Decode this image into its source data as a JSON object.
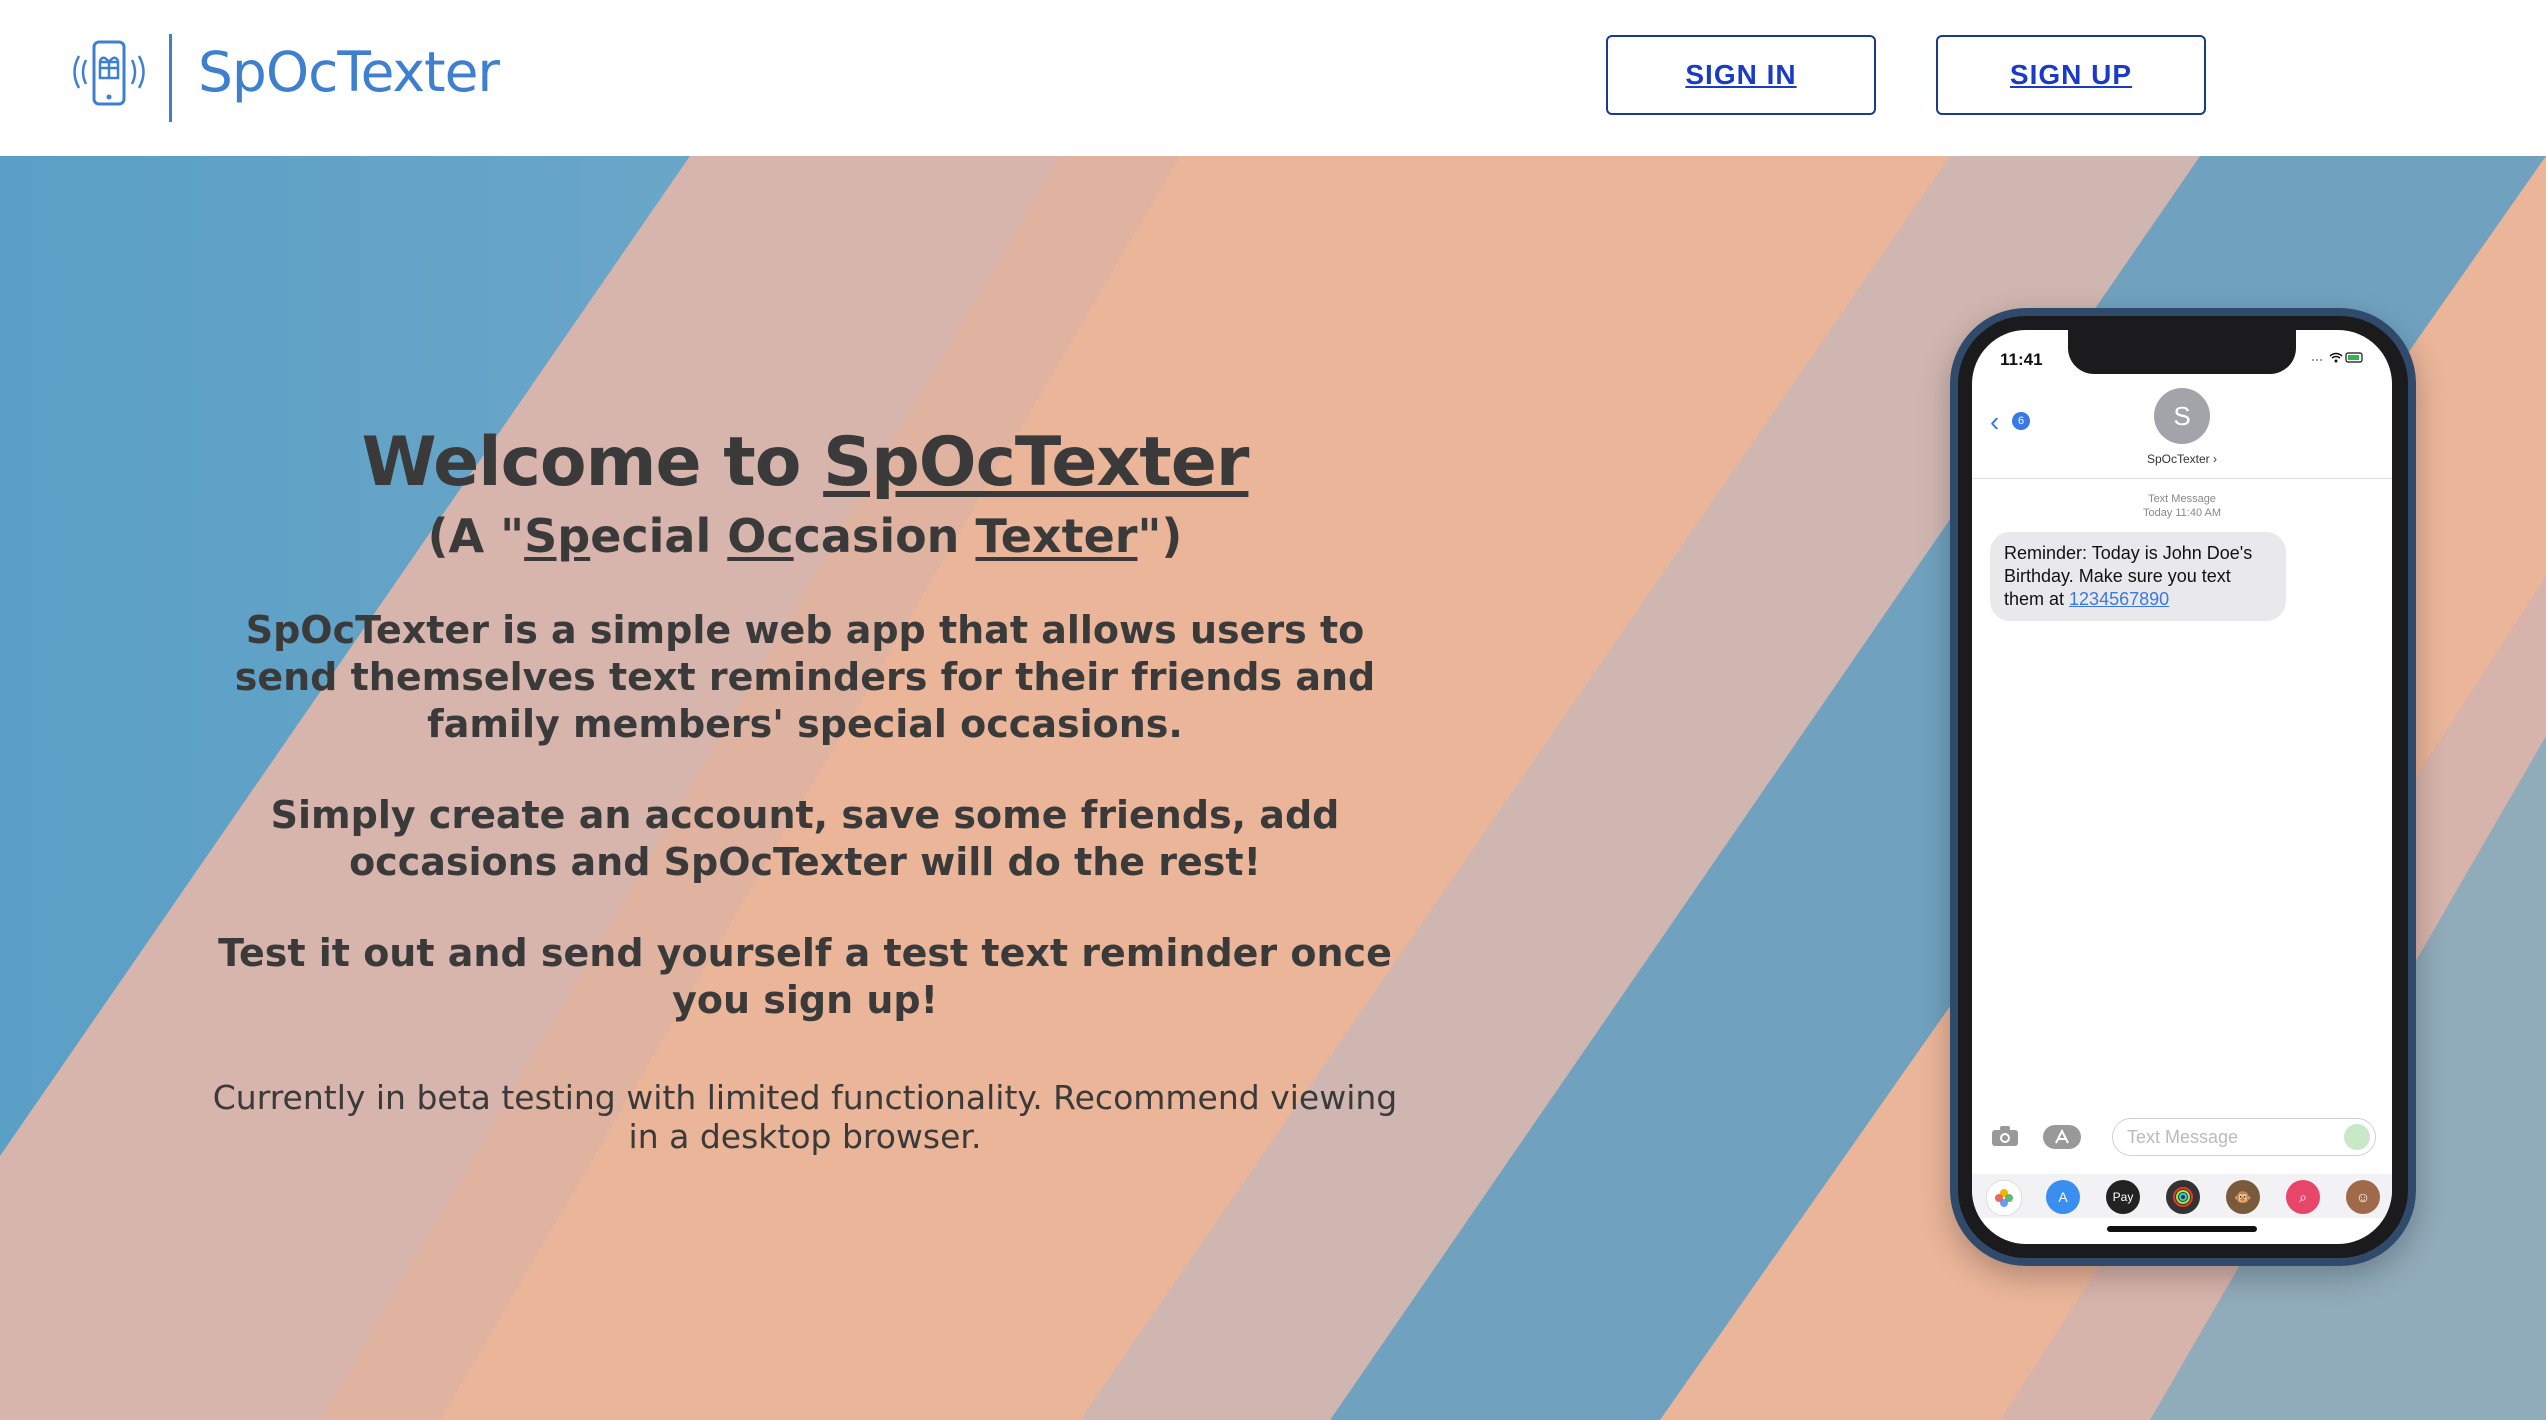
{
  "header": {
    "logo_text": "SpOcTexter",
    "sign_in": "SIGN IN",
    "sign_up": "SIGN UP"
  },
  "hero": {
    "welcome_prefix": "Welcome to ",
    "welcome_brand": "SpOcTexter",
    "subtitle": {
      "open": "(A \"",
      "sp": "Sp",
      "ecial": "ecial ",
      "oc": "Oc",
      "casion": "casion ",
      "texter": "Texter",
      "close": "\")"
    },
    "paragraph1": "SpOcTexter is a simple web app that allows users to send themselves text reminders for their friends and family members' special occasions.",
    "paragraph2": "Simply create an account, save some friends, add occasions and SpOcTexter will do the rest!",
    "paragraph3": "Test it out and send yourself a test text reminder once you sign up!",
    "beta_note": "Currently in beta testing with limited functionality. Recommend viewing in a desktop browser."
  },
  "phone": {
    "time": "11:41",
    "back_badge": "6",
    "avatar_letter": "S",
    "contact_name": "SpOcTexter ›",
    "message_type": "Text Message",
    "message_time": "Today 11:40 AM",
    "message_text": "Reminder: Today is John Doe's Birthday. Make sure you text them at ",
    "message_phone": "1234567890",
    "input_placeholder": "Text Message",
    "apple_pay": "Pay"
  },
  "colors": {
    "brand_blue": "#3f7fcf",
    "button_text": "#1a3ac8",
    "hero_peach": "#eab599",
    "hero_blue": "#5a9fc6"
  }
}
